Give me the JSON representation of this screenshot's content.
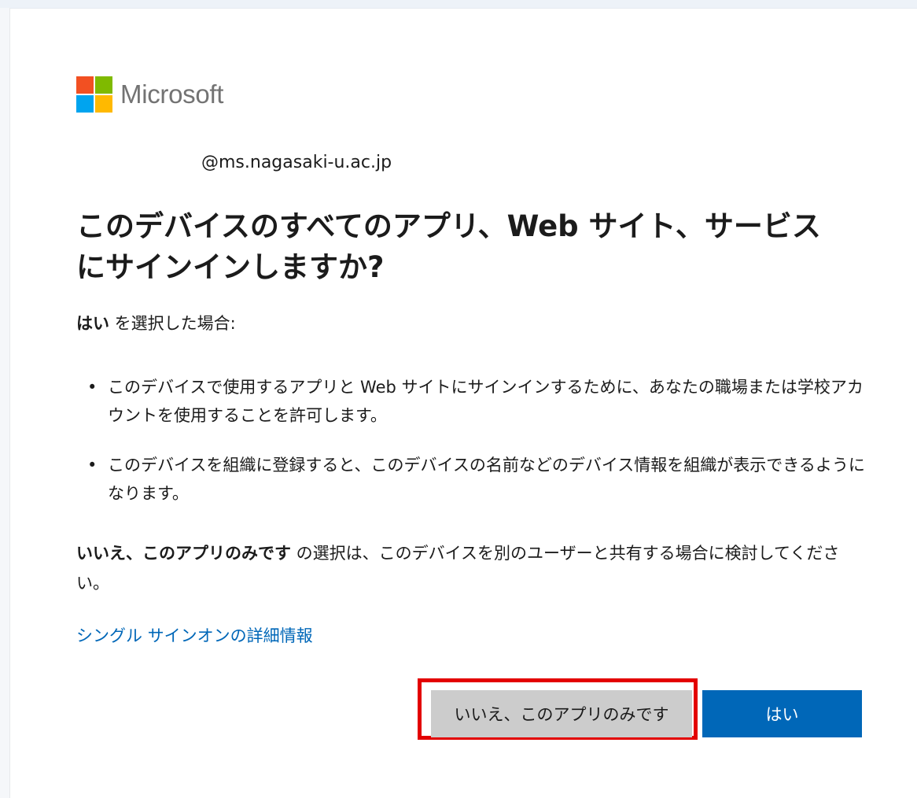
{
  "logo": {
    "text": "Microsoft",
    "colors": [
      "#f25022",
      "#7fba00",
      "#00a4ef",
      "#ffb900"
    ]
  },
  "account": "@ms.nagasaki-u.ac.jp",
  "title": "このデバイスのすべてのアプリ、Web サイト、サービスにサインインしますか?",
  "intro": {
    "bold": "はい",
    "rest": " を選択した場合:"
  },
  "bullets": [
    {
      "bullet": "•",
      "text": "このデバイスで使用するアプリと Web サイトにサインインするために、あなたの職場または学校アカウントを使用することを許可します。"
    },
    {
      "bullet": "•",
      "text": "このデバイスを組織に登録すると、このデバイスの名前などのデバイス情報を組織が表示できるようになります。"
    }
  ],
  "note": {
    "bold": "いいえ、このアプリのみです",
    "rest": " の選択は、このデバイスを別のユーザーと共有する場合に検討してください。"
  },
  "link": "シングル サインオンの詳細情報",
  "buttons": {
    "no": "いいえ、このアプリのみです",
    "yes": "はい"
  },
  "colors": {
    "primary": "#0067b8",
    "secondary_button": "#cccccc",
    "highlight": "#e30000",
    "text": "#1b1b1b"
  }
}
